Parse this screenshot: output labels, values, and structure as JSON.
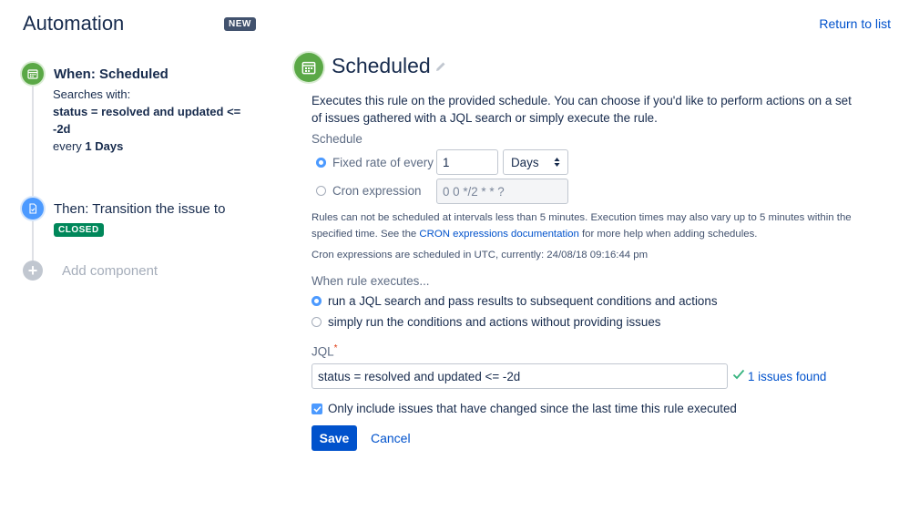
{
  "header": {
    "title": "Automation",
    "new_badge": "NEW",
    "return_link": "Return to list"
  },
  "rail": {
    "when": {
      "title": "When: Scheduled",
      "searches_with": "Searches with:",
      "query_line1": "status = resolved and updated <=",
      "query_line2": "-2d",
      "every_prefix": "every ",
      "every_value": "1 Days"
    },
    "then": {
      "title": "Then: Transition the issue to",
      "badge": "CLOSED"
    },
    "add_component": "Add component"
  },
  "panel": {
    "title": "Scheduled",
    "description": "Executes this rule on the provided schedule. You can choose if you'd like to perform actions on a set of issues gathered with a JQL search or simply execute the rule.",
    "schedule_label": "Schedule",
    "fixed_rate_label": "Fixed rate of every",
    "fixed_rate_value": "1",
    "unit_value": "Days",
    "cron_label": "Cron expression",
    "cron_placeholder": "0 0 */2 * * ?",
    "note_part1": "Rules can not be scheduled at intervals less than 5 minutes. Execution times may also vary up to 5 minutes within the specified time. See the ",
    "note_link": "CRON expressions documentation",
    "note_part2": " for more help when adding schedules.",
    "utc_note": "Cron expressions are scheduled in UTC, currently: 24/08/18 09:16:44 pm",
    "when_executes_label": "When rule executes...",
    "option_jql": "run a JQL search and pass results to subsequent conditions and actions",
    "option_simple": "simply run the conditions and actions without providing issues",
    "jql_label": "JQL",
    "required_mark": "*",
    "jql_value": "status = resolved and updated <= -2d",
    "issues_found": "1 issues found",
    "only_changed": "Only include issues that have changed since the last time this rule executed",
    "save": "Save",
    "cancel": "Cancel"
  },
  "colors": {
    "accent": "#0052cc",
    "trigger_green": "#5aa846",
    "action_blue": "#4c9aff",
    "closed_green": "#00875a",
    "success_green": "#36b37e"
  }
}
